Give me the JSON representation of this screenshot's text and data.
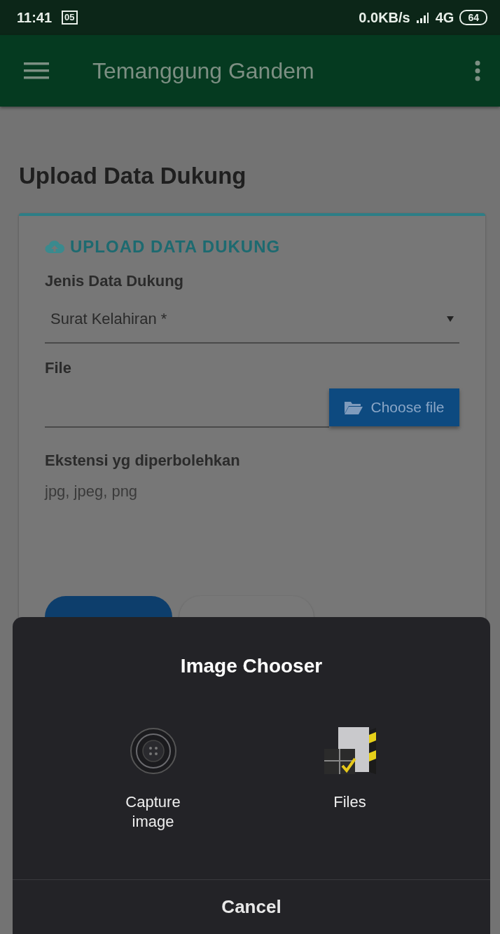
{
  "status_bar": {
    "time": "11:41",
    "badge": "05",
    "network_speed": "0.0KB/s",
    "network_type": "4G",
    "battery": "64"
  },
  "app_bar": {
    "title": "Temanggung Gandem"
  },
  "page": {
    "title": "Upload Data Dukung"
  },
  "card": {
    "header": "UPLOAD DATA DUKUNG",
    "fields": [
      {
        "kind": "select",
        "label": "Jenis Data Dukung",
        "value": "Surat Kelahiran *"
      },
      {
        "kind": "file",
        "label": "File",
        "button": "Choose file"
      }
    ],
    "note_label": "Ekstensi yg diperbolehkan",
    "note_value": "jpg, jpeg, png",
    "buttons": [
      {
        "kind": "primary"
      },
      {
        "kind": "secondary"
      }
    ]
  },
  "dialog": {
    "title": "Image Chooser",
    "options": [
      {
        "kind": "camera",
        "label": "Capture image"
      },
      {
        "kind": "files",
        "label": "Files"
      }
    ],
    "cancel": "Cancel"
  }
}
